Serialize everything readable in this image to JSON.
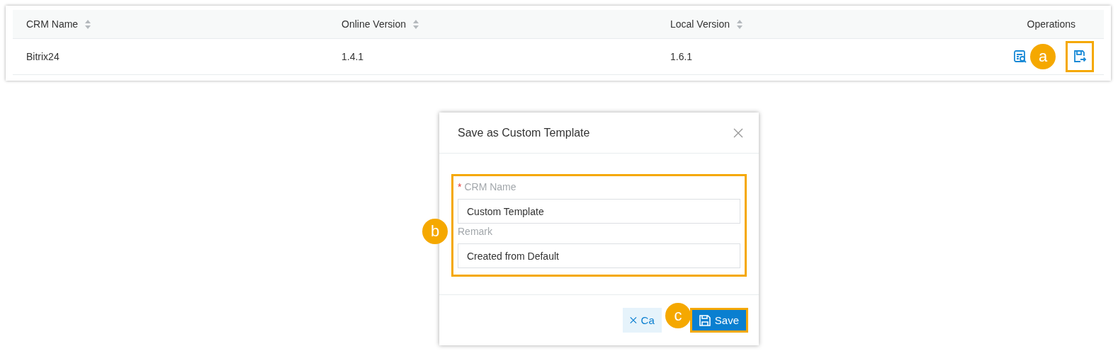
{
  "table": {
    "columns": [
      {
        "label": "CRM Name",
        "sortable": true
      },
      {
        "label": "Online Version",
        "sortable": true
      },
      {
        "label": "Local Version",
        "sortable": true
      },
      {
        "label": "Operations",
        "sortable": false
      }
    ],
    "rows": [
      {
        "cells": [
          "Bitrix24",
          "1.4.1",
          "1.6.1"
        ],
        "operations": [
          {
            "kind": "preview",
            "highlighted": false
          },
          {
            "kind": "save",
            "highlighted": true
          }
        ],
        "callout": "a"
      }
    ]
  },
  "dialog": {
    "title": "Save as Custom Template",
    "form_highlighted": true,
    "form_callout": "b",
    "fields": [
      {
        "label": "CRM Name",
        "required_mark": "*",
        "value": "Custom Template"
      },
      {
        "label": "Remark",
        "value": "Created from Default"
      }
    ],
    "buttons": [
      {
        "kind": "cancel",
        "label": "Ca",
        "highlighted": false
      },
      {
        "kind": "save",
        "label": "Save",
        "highlighted": true
      }
    ],
    "button_callout": "c"
  }
}
